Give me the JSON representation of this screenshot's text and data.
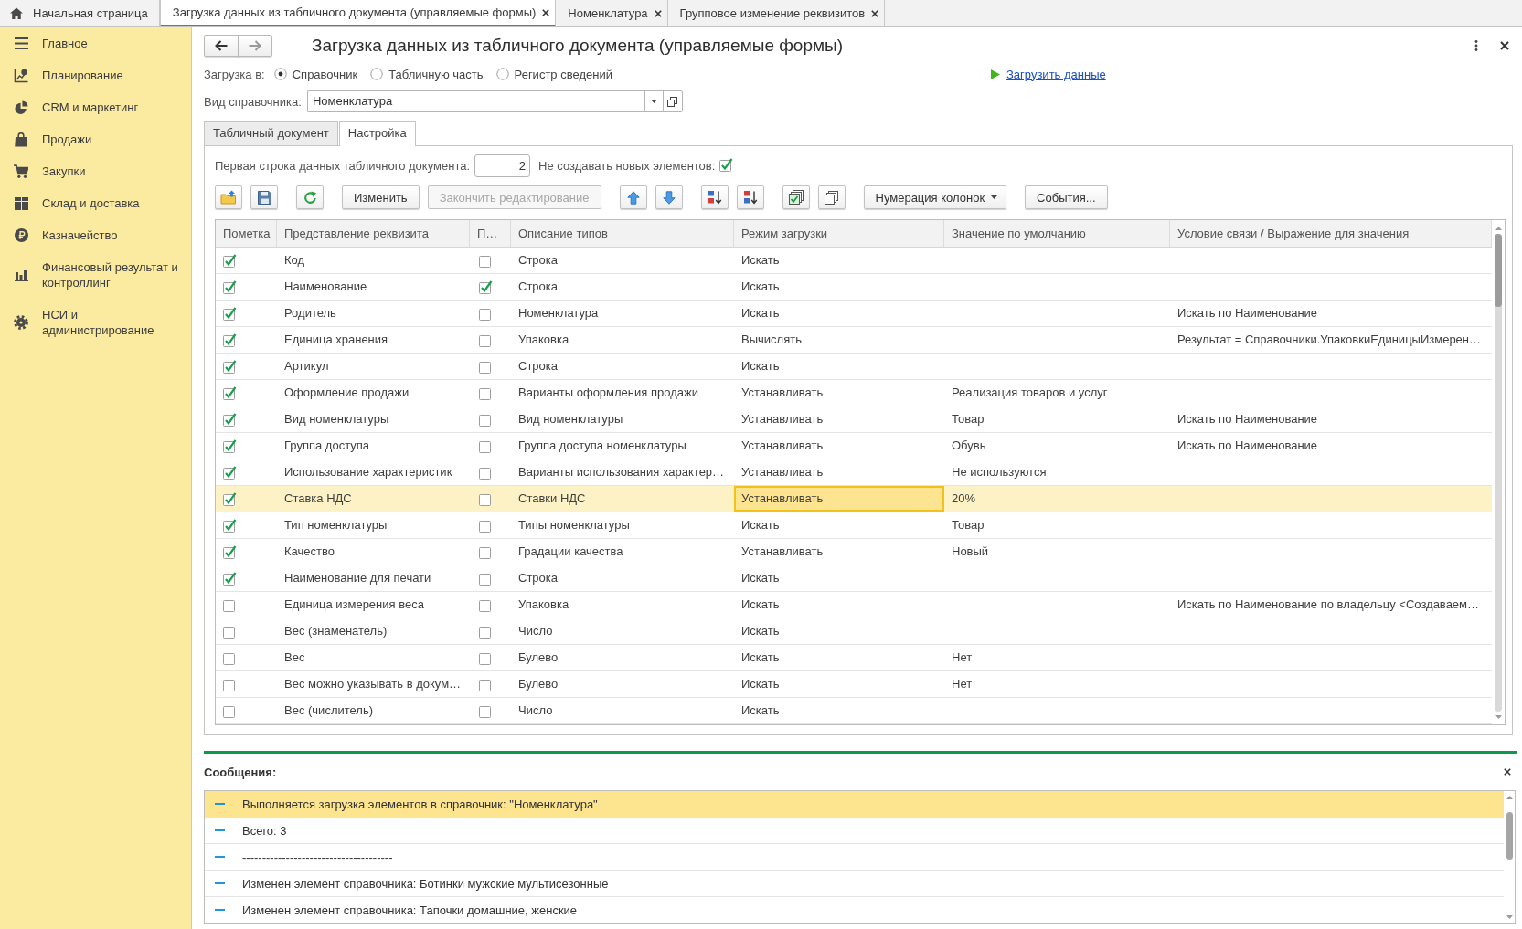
{
  "tabs": [
    {
      "kind": "home",
      "label": "Начальная страница",
      "selected": false
    },
    {
      "kind": "page",
      "label": "Загрузка данных из табличного документа (управляемые формы)",
      "selected": true
    },
    {
      "kind": "page",
      "label": "Номенклатура",
      "selected": false
    },
    {
      "kind": "page",
      "label": "Групповое изменение реквизитов",
      "selected": false
    }
  ],
  "sidebar": {
    "items": [
      {
        "label": "Главное"
      },
      {
        "label": "Планирование"
      },
      {
        "label": "CRM и маркетинг"
      },
      {
        "label": "Продажи"
      },
      {
        "label": "Закупки"
      },
      {
        "label": "Склад и доставка"
      },
      {
        "label": "Казначейство"
      },
      {
        "label": "Финансовый результат и контроллинг"
      },
      {
        "label": "НСИ и администрирование"
      }
    ]
  },
  "form": {
    "title": "Загрузка данных из табличного документа (управляемые формы)",
    "load_target": {
      "label": "Загрузка в:",
      "options": [
        {
          "label": "Справочник",
          "selected": true
        },
        {
          "label": "Табличную часть",
          "selected": false
        },
        {
          "label": "Регистр сведений",
          "selected": false
        }
      ]
    },
    "load_link": "Загрузить данные",
    "catalog_type": {
      "label": "Вид справочника:",
      "value": "Номенклатура"
    },
    "tabs": [
      {
        "label": "Табличный документ",
        "selected": false
      },
      {
        "label": "Настройка",
        "selected": true
      }
    ],
    "first_row": {
      "label": "Первая строка данных табличного документа:",
      "value": "2"
    },
    "no_new_items": {
      "label": "Не создавать новых элементов:",
      "checked": true
    },
    "toolbar": {
      "buttons": [
        {
          "label": "Изменить",
          "disabled": false,
          "dropdown": false
        },
        {
          "label": "Закончить редактирование",
          "disabled": true,
          "dropdown": false
        },
        {
          "label": "Нумерация колонок",
          "disabled": false,
          "dropdown": true
        },
        {
          "label": "События...",
          "disabled": false,
          "dropdown": false
        }
      ]
    },
    "table": {
      "columns": [
        {
          "label": "Пометка",
          "current": false
        },
        {
          "label": "Представление реквизита",
          "current": false
        },
        {
          "label": "П…",
          "current": false
        },
        {
          "label": "Описание типов",
          "current": false
        },
        {
          "label": "Режим загрузки",
          "current": true
        },
        {
          "label": "Значение по умолчанию",
          "current": false
        },
        {
          "label": "Условие связи / Выражение для значения",
          "current": false
        }
      ],
      "rows": [
        {
          "checked": true,
          "name": "Код",
          "column_3": false,
          "types": "Строка",
          "mode": "Искать",
          "selected": false
        },
        {
          "checked": true,
          "name": "Наименование",
          "column_3": true,
          "types": "Строка",
          "mode": "Искать",
          "selected": false
        },
        {
          "checked": true,
          "name": "Родитель",
          "column_3": false,
          "types": "Номенклатура",
          "mode": "Искать",
          "condition": "Искать по Наименование",
          "selected": false
        },
        {
          "checked": true,
          "name": "Единица хранения",
          "column_3": false,
          "types": "Упаковка",
          "mode": "Вычислять",
          "condition": "Результат = Справочники.УпаковкиЕдиницыИзмерен…",
          "selected": false
        },
        {
          "checked": true,
          "name": "Артикул",
          "column_3": false,
          "types": "Строка",
          "mode": "Искать",
          "selected": false
        },
        {
          "checked": true,
          "name": "Оформление продажи",
          "column_3": false,
          "types": "Варианты оформления продажи",
          "mode": "Устанавливать",
          "default": "Реализация товаров и услуг",
          "selected": false
        },
        {
          "checked": true,
          "name": "Вид номенклатуры",
          "column_3": false,
          "types": "Вид номенклатуры",
          "mode": "Устанавливать",
          "default": "Товар",
          "condition": "Искать по Наименование",
          "selected": false
        },
        {
          "checked": true,
          "name": "Группа доступа",
          "column_3": false,
          "types": "Группа доступа номенклатуры",
          "mode": "Устанавливать",
          "default": "Обувь",
          "condition": "Искать по Наименование",
          "selected": false
        },
        {
          "checked": true,
          "name": "Использование характеристик",
          "column_3": false,
          "types": "Варианты использования характер…",
          "mode": "Устанавливать",
          "default": "Не используются",
          "selected": false
        },
        {
          "checked": true,
          "name": "Ставка НДС",
          "column_3": false,
          "types": "Ставки НДС",
          "mode": "Устанавливать",
          "default": "20%",
          "selected": true
        },
        {
          "checked": true,
          "name": "Тип номенклатуры",
          "column_3": false,
          "types": "Типы номенклатуры",
          "mode": "Искать",
          "default": "Товар",
          "selected": false
        },
        {
          "checked": true,
          "name": "Качество",
          "column_3": false,
          "types": "Градации качества",
          "mode": "Устанавливать",
          "default": "Новый",
          "selected": false
        },
        {
          "checked": true,
          "name": "Наименование для печати",
          "column_3": false,
          "types": "Строка",
          "mode": "Искать",
          "selected": false
        },
        {
          "checked": false,
          "name": "Единица измерения веса",
          "column_3": false,
          "types": "Упаковка",
          "mode": "Искать",
          "condition": "Искать по Наименование по владельцу <Создаваем…",
          "selected": false
        },
        {
          "checked": false,
          "name": "Вес (знаменатель)",
          "column_3": false,
          "types": "Число",
          "mode": "Искать",
          "selected": false
        },
        {
          "checked": false,
          "name": "Вес",
          "column_3": false,
          "types": "Булево",
          "mode": "Искать",
          "default": "Нет",
          "selected": false
        },
        {
          "checked": false,
          "name": "Вес можно указывать в докум…",
          "column_3": false,
          "types": "Булево",
          "mode": "Искать",
          "default": "Нет",
          "selected": false
        },
        {
          "checked": false,
          "name": "Вес (числитель)",
          "column_3": false,
          "types": "Число",
          "mode": "Искать",
          "selected": false
        }
      ]
    }
  },
  "messages": {
    "title": "Сообщения:",
    "items": [
      {
        "text": "Выполняется загрузка элементов в справочник: \"Номенклатура\"",
        "selected": true
      },
      {
        "text": "Всего: 3",
        "selected": false
      },
      {
        "text": "--------------------------------------",
        "selected": false
      },
      {
        "text": "Изменен элемент справочника: Ботинки мужские мультисезонные",
        "selected": false
      },
      {
        "text": "Изменен элемент справочника: Тапочки домашние, женские",
        "selected": false
      }
    ]
  }
}
